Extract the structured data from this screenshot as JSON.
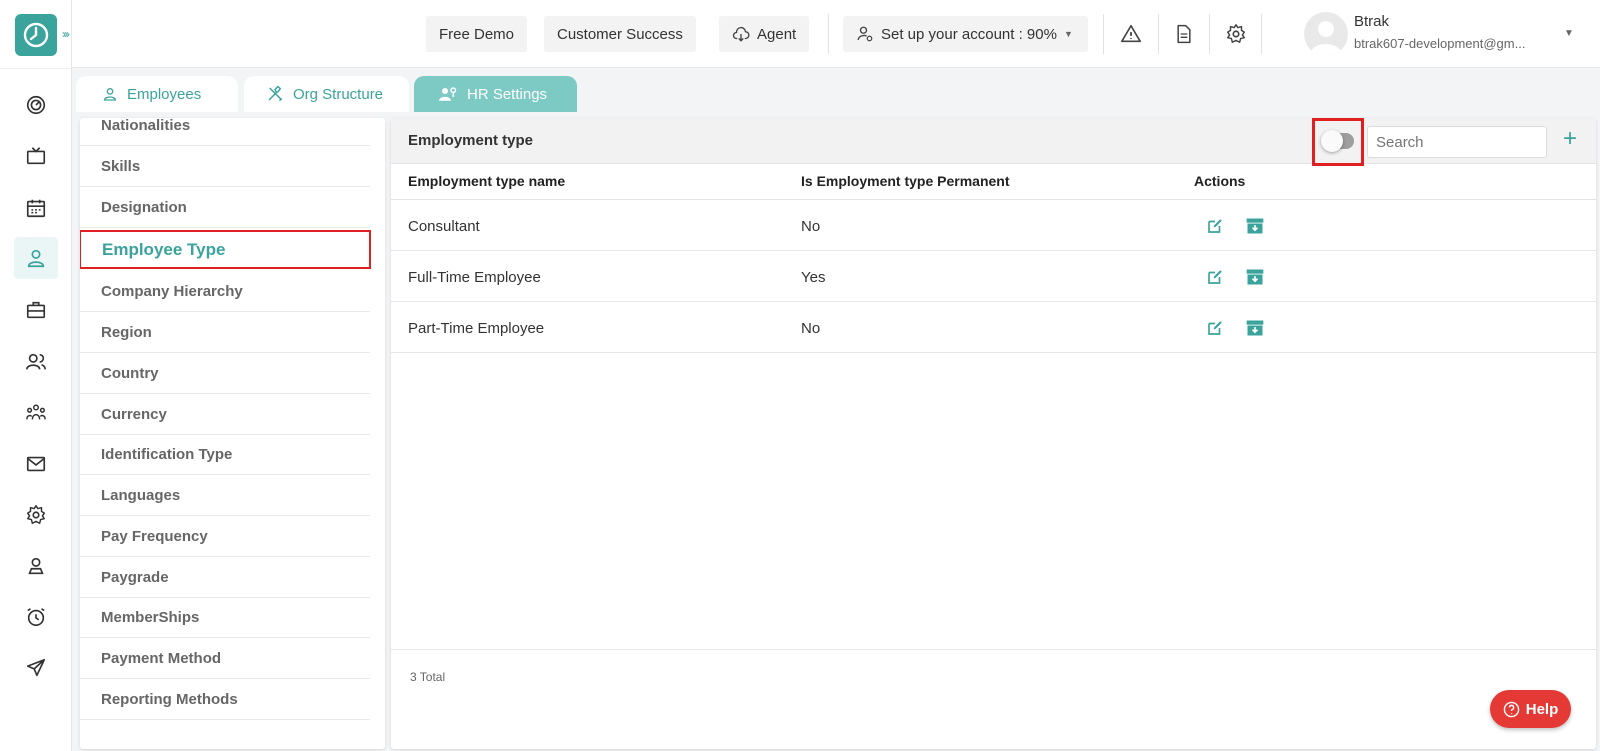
{
  "topbar": {
    "free_demo": "Free Demo",
    "customer_success": "Customer Success",
    "agent": "Agent",
    "setup": "Set up your account : 90%",
    "user_name": "Btrak",
    "user_email": "btrak607-development@gm..."
  },
  "tabs": [
    {
      "label": "Employees",
      "icon": "user-icon"
    },
    {
      "label": "Org Structure",
      "icon": "tools-icon"
    },
    {
      "label": "HR Settings",
      "icon": "hr-settings-icon"
    }
  ],
  "settings_menu": [
    "Nationalities",
    "Skills",
    "Designation",
    "Employee Type",
    "Company Hierarchy",
    "Region",
    "Country",
    "Currency",
    "Identification Type",
    "Languages",
    "Pay Frequency",
    "Paygrade",
    "MemberShips",
    "Payment Method",
    "Reporting Methods"
  ],
  "main": {
    "title": "Employment type",
    "search_placeholder": "Search",
    "add_symbol": "+",
    "columns": [
      "Employment type name",
      "Is Employment type Permanent",
      "Actions"
    ],
    "rows": [
      {
        "name": "Consultant",
        "permanent": "No"
      },
      {
        "name": "Full-Time Employee",
        "permanent": "Yes"
      },
      {
        "name": "Part-Time Employee",
        "permanent": "No"
      }
    ],
    "total": "3 Total"
  },
  "help": "Help",
  "colors": {
    "accent": "#3aa39b",
    "highlight": "#e02020",
    "help": "#e53935"
  }
}
